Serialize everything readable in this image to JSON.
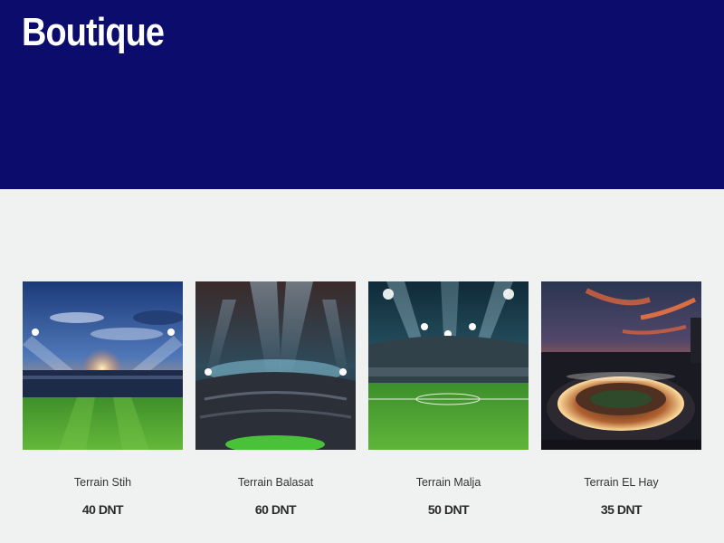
{
  "header": {
    "title": "Boutique",
    "background": "#0b0c6b"
  },
  "products": [
    {
      "name": "Terrain Stih",
      "price": "40 DNT",
      "image": "stadium-sunset-floodlights"
    },
    {
      "name": "Terrain Balasat",
      "price": "60 DNT",
      "image": "stadium-spotlights-dark"
    },
    {
      "name": "Terrain Malja",
      "price": "50 DNT",
      "image": "stadium-night-pitch"
    },
    {
      "name": "Terrain EL Hay",
      "price": "35 DNT",
      "image": "stadium-aerial-dusk"
    }
  ]
}
